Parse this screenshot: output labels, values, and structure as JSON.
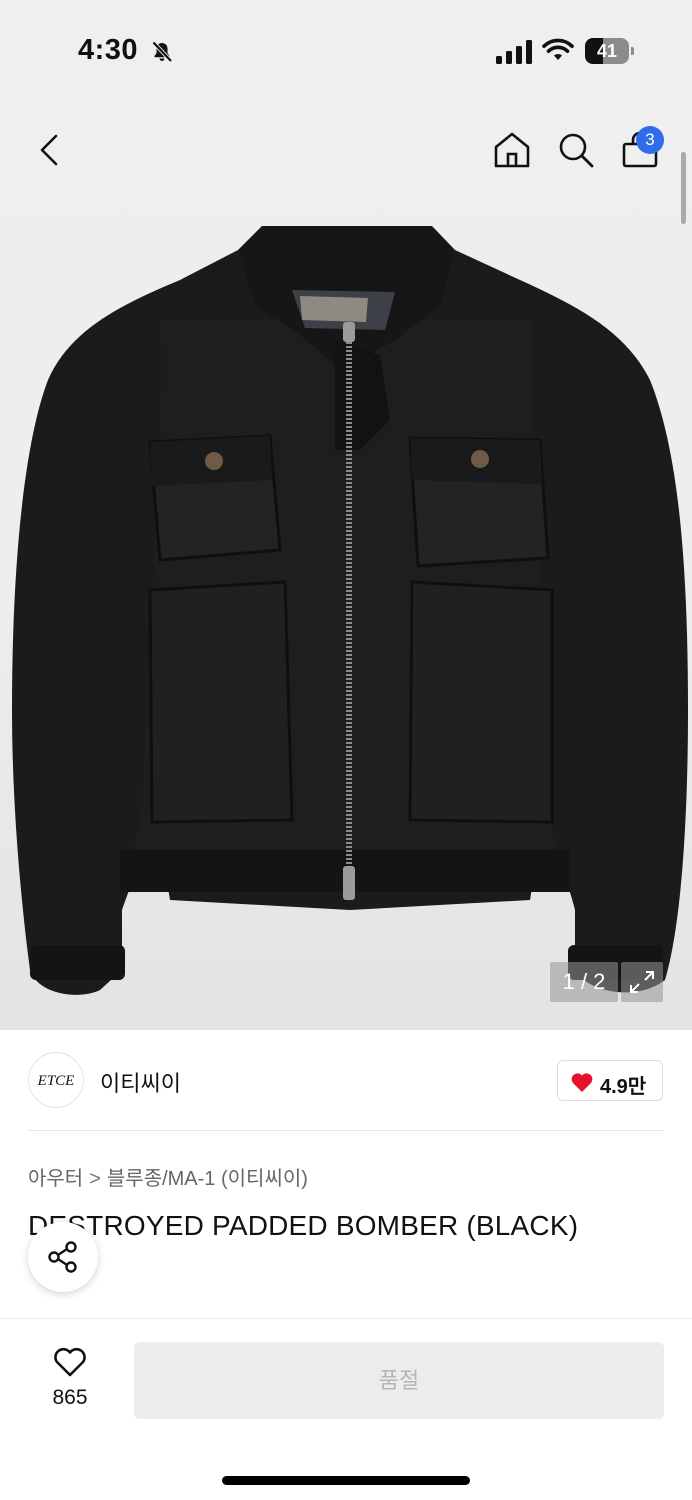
{
  "status_bar": {
    "time": "4:30",
    "battery_level": "41",
    "battery_fraction": 0.41,
    "icons": [
      "bell-off-icon",
      "signal-icon",
      "wifi-icon",
      "battery-icon"
    ]
  },
  "nav": {
    "icons": [
      "back-arrow-icon",
      "home-icon",
      "search-icon",
      "shopping-bag-icon"
    ],
    "cart_badge": "3",
    "badge_color": "#2f6bea"
  },
  "gallery": {
    "counter": "1 / 2",
    "expand_icon": "expand-icon"
  },
  "brand": {
    "logo_text": "ETCE",
    "name": "이티씨이",
    "likes": "4.9만",
    "heart_color": "#e8112d"
  },
  "product": {
    "breadcrumb": [
      "아우터",
      "블루종/MA-1 (이티씨이)"
    ],
    "breadcrumb_sep": ">",
    "title": "DESTROYED PADDED BOMBER (BLACK)"
  },
  "actions": {
    "wish_count": "865",
    "buy_button": "품절"
  }
}
